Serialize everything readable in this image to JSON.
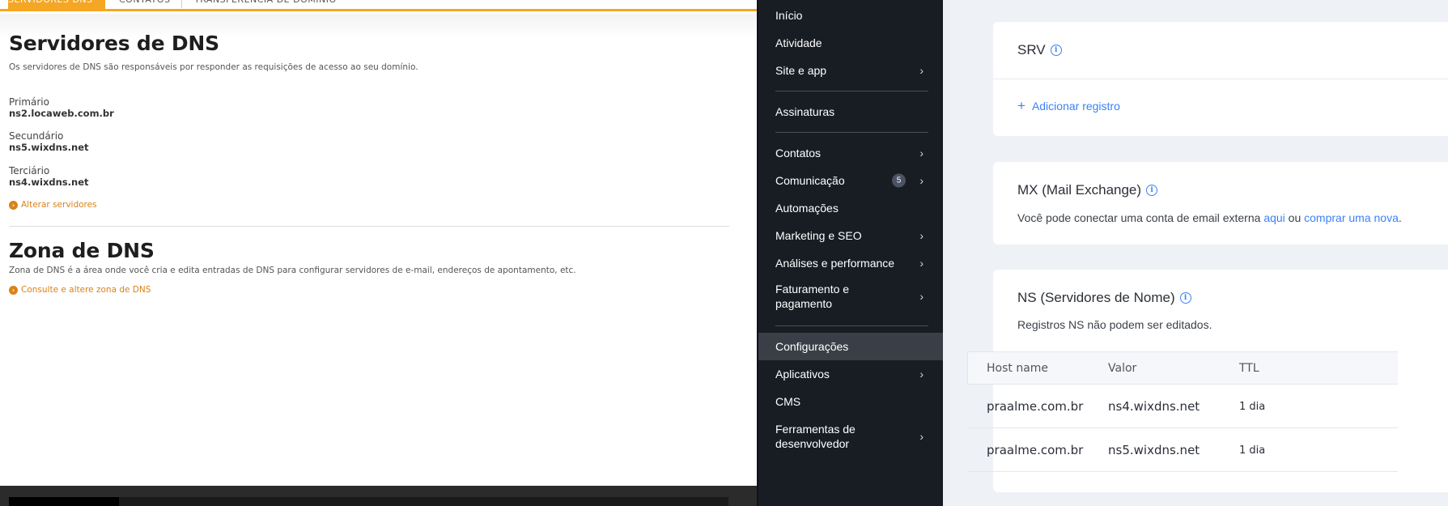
{
  "left_panel": {
    "tabs": [
      "SERVIDORES DNS",
      "CONTATOS",
      "TRANSFERÊNCIA DE DOMÍNIO"
    ],
    "dns_servers": {
      "title": "Servidores de DNS",
      "description": "Os servidores de DNS são responsáveis por responder as requisições de acesso ao seu domínio.",
      "primary_label": "Primário",
      "primary_value": "ns2.locaweb.com.br",
      "secondary_label": "Secundário",
      "secondary_value": "ns5.wixdns.net",
      "tertiary_label": "Terciário",
      "tertiary_value": "ns4.wixdns.net",
      "change_link": "Alterar servidores"
    },
    "dns_zone": {
      "title": "Zona de DNS",
      "description": "Zona de DNS é a área onde você cria e edita entradas de DNS para configurar servidores de e-mail, endereços de apontamento, etc.",
      "link": "Consulte e altere zona de DNS"
    }
  },
  "sidebar": {
    "items": [
      {
        "label": "Início"
      },
      {
        "label": "Atividade"
      },
      {
        "label": "Site e app",
        "chevron": true
      },
      {
        "label": "Assinaturas"
      },
      {
        "label": "Contatos",
        "chevron": true
      },
      {
        "label": "Comunicação",
        "chevron": true,
        "badge": "5"
      },
      {
        "label": "Automações"
      },
      {
        "label": "Marketing e SEO",
        "chevron": true
      },
      {
        "label": "Análises e performance",
        "chevron": true
      },
      {
        "label": "Faturamento e pagamento",
        "chevron": true
      },
      {
        "label": "Configurações",
        "active": true
      },
      {
        "label": "Aplicativos",
        "chevron": true
      },
      {
        "label": "CMS"
      },
      {
        "label": "Ferramentas de desenvolvedor",
        "chevron": true
      }
    ]
  },
  "main": {
    "srv": {
      "title": "SRV",
      "add_record": "Adicionar registro"
    },
    "mx": {
      "title": "MX (Mail Exchange)",
      "text_before": "Você pode conectar uma conta de email externa ",
      "link_here": "aqui",
      "text_middle": " ou ",
      "link_buy": "comprar uma nova",
      "text_after": "."
    },
    "ns": {
      "title": "NS (Servidores de Nome)",
      "note": "Registros NS não podem ser editados.",
      "columns": [
        "Host name",
        "Valor",
        "TTL"
      ],
      "rows": [
        {
          "host": "praalme.com.br",
          "value": "ns4.wixdns.net",
          "ttl": "1 dia"
        },
        {
          "host": "praalme.com.br",
          "value": "ns5.wixdns.net",
          "ttl": "1 dia"
        }
      ]
    }
  },
  "colors": {
    "accent_orange": "#f5a623",
    "link_orange": "#d9821a",
    "sidebar_bg": "#181d24",
    "link_blue": "#3b82f6"
  },
  "icons": [
    "info-icon",
    "plus-icon",
    "chevron-right-icon",
    "arrow-circle-icon"
  ]
}
